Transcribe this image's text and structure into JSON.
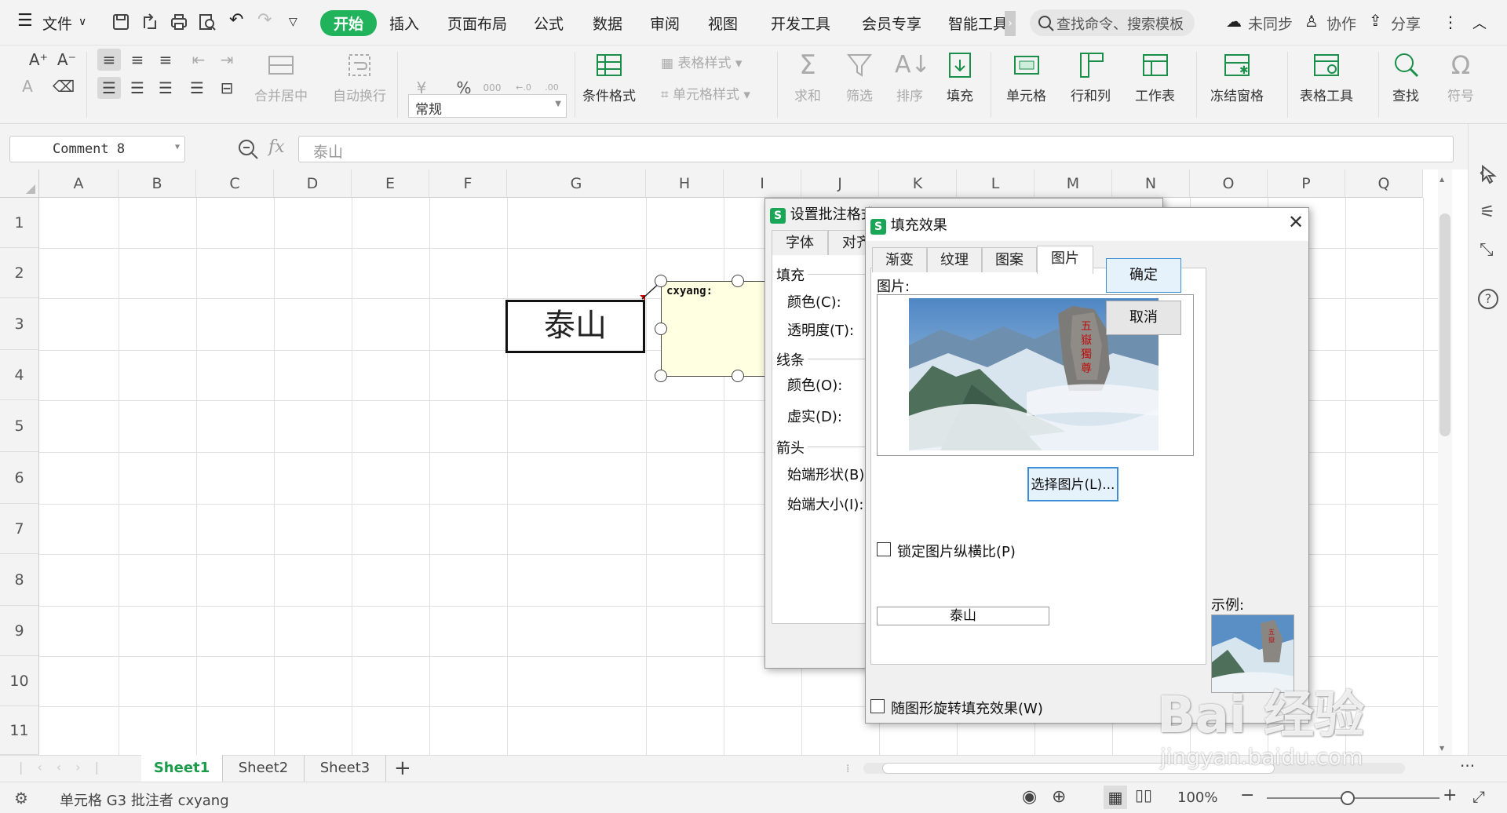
{
  "menubar": {
    "file_menu": "文件",
    "tabs": [
      "开始",
      "插入",
      "页面布局",
      "公式",
      "数据",
      "审阅",
      "视图",
      "开发工具",
      "会员专享",
      "智能工具"
    ],
    "search_placeholder": "查找命令、搜索模板",
    "sync": "未同步",
    "collab": "协作",
    "share": "分享"
  },
  "ribbon": {
    "number_format": "常规",
    "merge_center": "合并居中",
    "auto_wrap": "自动换行",
    "cond_format": "条件格式",
    "table_style": "表格样式",
    "cell_style": "单元格样式",
    "sum": "求和",
    "filter": "筛选",
    "sort": "排序",
    "fill": "填充",
    "cell": "单元格",
    "row_col": "行和列",
    "worksheet": "工作表",
    "freeze": "冻结窗格",
    "table_tools": "表格工具",
    "find": "查找",
    "symbol": "符号",
    "currency_symbol": "¥",
    "percent_symbol": "%",
    "thousands_symbol": "000"
  },
  "formula_bar": {
    "name_box": "Comment 8",
    "fx": "fx",
    "content": "泰山"
  },
  "grid": {
    "columns": [
      "A",
      "B",
      "C",
      "D",
      "E",
      "F",
      "G",
      "H",
      "I",
      "J",
      "K",
      "L",
      "M",
      "N",
      "O",
      "P",
      "Q"
    ],
    "rows": [
      "1",
      "2",
      "3",
      "4",
      "5",
      "6",
      "7",
      "8",
      "9",
      "10",
      "11"
    ],
    "cell_g3": "泰山",
    "comment_author": "cxyang:"
  },
  "sheets": [
    "Sheet1",
    "Sheet2",
    "Sheet3"
  ],
  "status": {
    "text": "单元格 G3 批注者 cxyang",
    "zoom": "100%"
  },
  "dialog_comment": {
    "title": "设置批注格式",
    "tabs": [
      "字体",
      "对齐"
    ],
    "fill_section": "填充",
    "color": "颜色(C):",
    "transparency": "透明度(T):",
    "line_section": "线条",
    "line_color": "颜色(O):",
    "dash": "虚实(D):",
    "arrow_section": "箭头",
    "begin_style": "始端形状(B):",
    "begin_size": "始端大小(I):"
  },
  "dialog_fill": {
    "title": "填充效果",
    "tabs": [
      "渐变",
      "纹理",
      "图案",
      "图片"
    ],
    "picture_label": "图片:",
    "picture_name": "泰山",
    "select_button": "选择图片(L)...",
    "ok": "确定",
    "cancel": "取消",
    "sample": "示例:",
    "lock_ratio": "锁定图片纵横比(P)",
    "rotate_with_shape": "随图形旋转填充效果(W)"
  },
  "watermark": {
    "text": "Bai 经验",
    "url": "jingyan.baidu.com"
  },
  "colors": {
    "accent_green": "#21b35c",
    "ribbon_bg": "#f3f3f3",
    "comment_bg": "#ffffe1",
    "dialog_bg": "#f0f0f0"
  }
}
